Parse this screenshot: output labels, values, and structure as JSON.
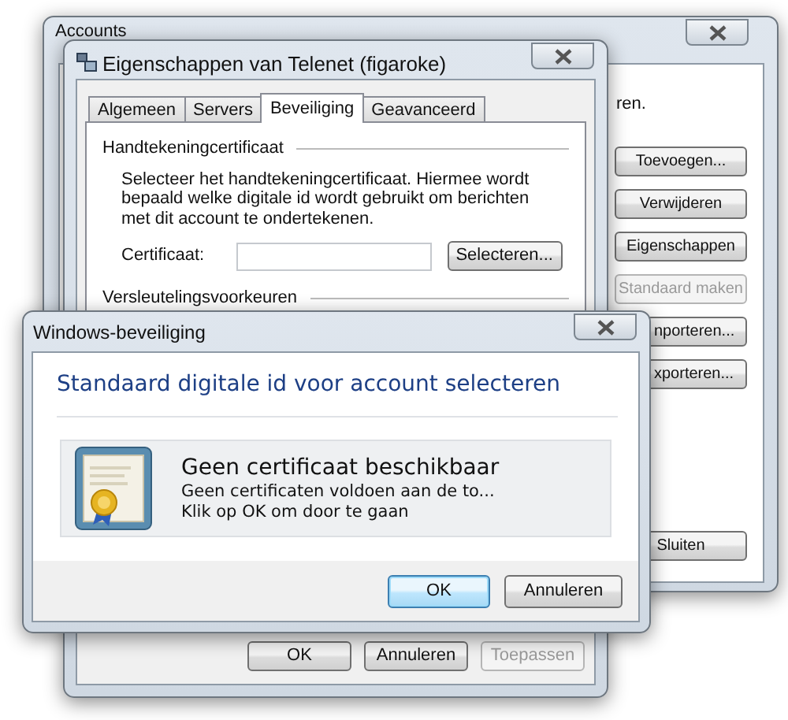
{
  "accounts_window": {
    "title": "Accounts",
    "text_fragment": "ren.",
    "buttons": [
      {
        "label": "Toevoegen...",
        "disabled": false
      },
      {
        "label": "Verwijderen",
        "disabled": false
      },
      {
        "label": "Eigenschappen",
        "disabled": false
      },
      {
        "label": "Standaard maken",
        "disabled": true
      },
      {
        "label": "nporteren...",
        "disabled": false
      },
      {
        "label": "xporteren...",
        "disabled": false
      }
    ],
    "close_label": "Sluiten"
  },
  "properties_window": {
    "title": "Eigenschappen van Telenet (figaroke)",
    "tabs": [
      {
        "label": "Algemeen",
        "selected": false
      },
      {
        "label": "Servers",
        "selected": false
      },
      {
        "label": "Beveiliging",
        "selected": true
      },
      {
        "label": "Geavanceerd",
        "selected": false
      }
    ],
    "signing_group": {
      "title": "Handtekeningcertificaat",
      "description": "Selecteer het handtekeningcertificaat. Hiermee wordt bepaald welke digitale id wordt gebruikt om berichten met dit account te ondertekenen.",
      "certificate_label": "Certificaat:",
      "select_button": "Selecteren..."
    },
    "encryption_group": {
      "title": "Versleutelingsvoorkeuren"
    },
    "buttons": [
      {
        "label": "OK",
        "disabled": false
      },
      {
        "label": "Annuleren",
        "disabled": false
      },
      {
        "label": "Toepassen",
        "disabled": true
      }
    ]
  },
  "security_dialog": {
    "title": "Windows-beveiliging",
    "heading": "Standaard digitale id voor account selecteren",
    "option": {
      "title": "Geen certificaat beschikbaar",
      "lines": [
        "Geen certificaten voldoen aan de to...",
        "Klik op OK om door te gaan"
      ]
    },
    "buttons": [
      {
        "label": "OK",
        "default": true
      },
      {
        "label": "Annuleren",
        "default": false
      }
    ]
  }
}
